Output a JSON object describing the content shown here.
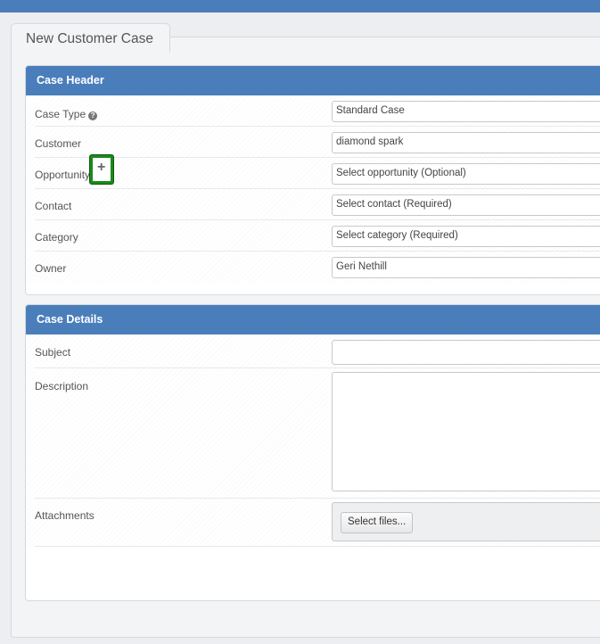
{
  "page": {
    "title": "New Customer Case"
  },
  "case_header": {
    "title": "Case Header",
    "case_type": {
      "label": "Case Type",
      "help_icon": "question-circle-icon",
      "value": "Standard Case"
    },
    "customer": {
      "label": "Customer",
      "value": "diamond spark"
    },
    "opportunity": {
      "label": "Opportunity",
      "add_icon": "plus-icon",
      "value": "Select opportunity (Optional)"
    },
    "contact": {
      "label": "Contact",
      "value": "Select contact (Required)"
    },
    "category": {
      "label": "Category",
      "value": "Select category (Required)"
    },
    "owner": {
      "label": "Owner",
      "value": "Geri Nethill"
    }
  },
  "case_details": {
    "title": "Case Details",
    "subject": {
      "label": "Subject",
      "value": ""
    },
    "description": {
      "label": "Description",
      "value": ""
    },
    "attachments": {
      "label": "Attachments",
      "button_label": "Select files..."
    }
  },
  "colors": {
    "header_blue": "#4a7ebb",
    "highlight_green": "#1a8a1a"
  }
}
